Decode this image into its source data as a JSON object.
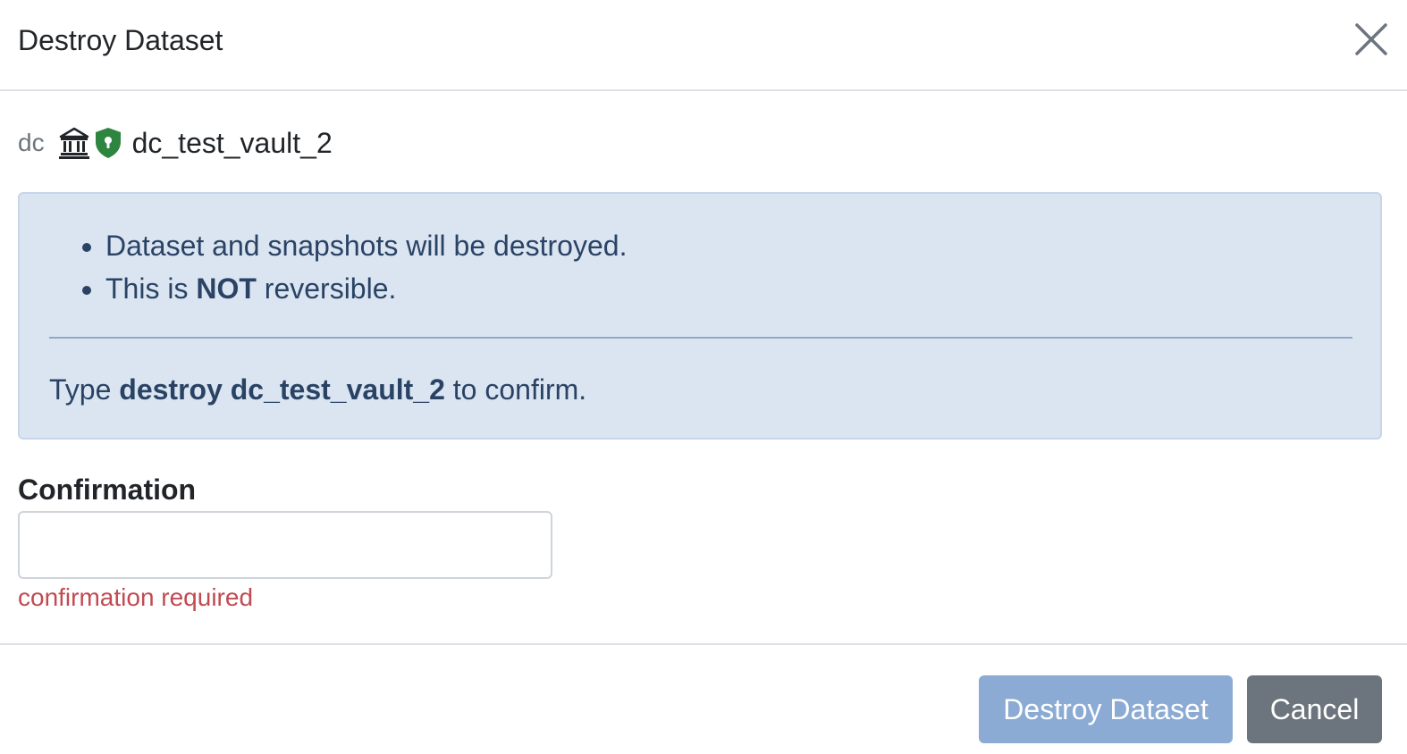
{
  "dialog": {
    "title": "Destroy Dataset"
  },
  "dataset": {
    "pool": "dc",
    "name": "dc_test_vault_2",
    "icons": [
      "vault-icon",
      "shield-keyhole-icon"
    ],
    "shield_color": "#2e8540"
  },
  "alert": {
    "bullets": [
      {
        "text": "Dataset and snapshots will be destroyed."
      },
      {
        "prefix": "This is ",
        "emphasis": "NOT",
        "suffix": " reversible."
      }
    ],
    "confirm_prefix": "Type ",
    "confirm_phrase": "destroy dc_test_vault_2",
    "confirm_suffix": " to confirm."
  },
  "form": {
    "label": "Confirmation",
    "value": "",
    "placeholder": "",
    "error": "confirmation required"
  },
  "footer": {
    "destroy_label": "Destroy Dataset",
    "cancel_label": "Cancel"
  },
  "colors": {
    "alert_bg": "#dbe5f1",
    "alert_text": "#2a4365",
    "error": "#c24a52",
    "destroy_button_disabled": "#8cabd4",
    "cancel_button": "#6c757d"
  }
}
